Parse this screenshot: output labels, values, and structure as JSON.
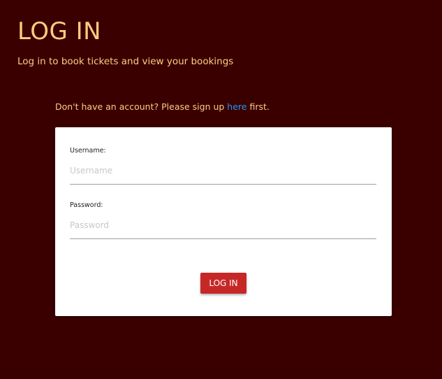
{
  "header": {
    "title": "LOG IN",
    "subtitle": "Log in to book tickets and view your bookings"
  },
  "signup": {
    "prefix": "Don't have an account? Please sign up ",
    "link_text": "here",
    "suffix": " first."
  },
  "form": {
    "username_label": "Username:",
    "username_placeholder": "Username",
    "username_value": "",
    "password_label": "Password:",
    "password_placeholder": "Password",
    "password_value": "",
    "submit_label": "LOG IN"
  },
  "colors": {
    "background": "#3a0000",
    "heading_text": "#ffcc80",
    "link": "#2196f3",
    "button": "#c62828",
    "card": "#ffffff"
  }
}
